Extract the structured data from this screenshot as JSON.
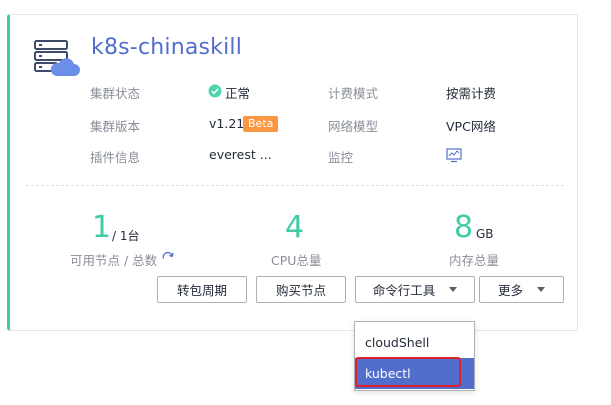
{
  "cluster": {
    "name": "k8s-chinaskill",
    "icon": "cluster-cloud-icon"
  },
  "info": {
    "status_label": "集群状态",
    "status_value": "正常",
    "status_icon": "check-circle-icon",
    "status_color": "#50d4ab",
    "version_label": "集群版本",
    "version_value": "v1.21",
    "version_badge": "Beta",
    "addons_label": "插件信息",
    "addons_value": "everest ...",
    "billing_label": "计费模式",
    "billing_value": "按需计费",
    "network_label": "网络模型",
    "network_value": "VPC网络",
    "monitor_label": "监控",
    "monitor_icon": "monitor-icon"
  },
  "stats": {
    "nodes_available": "1",
    "nodes_total": "/ 1台",
    "nodes_label": "可用节点 / 总数",
    "cpu_value": "4",
    "cpu_label": "CPU总量",
    "memory_value": "8",
    "memory_unit": "GB",
    "memory_label": "内存总量"
  },
  "actions": {
    "convert_period": "转包周期",
    "buy_node": "购买节点",
    "cli_tools": "命令行工具",
    "more": "更多"
  },
  "cli_menu": {
    "items": [
      "cloudShell",
      "kubectl"
    ],
    "hovered": "kubectl"
  },
  "colors": {
    "accent": "#3dcca6",
    "title_blue": "#526ecc",
    "badge_orange": "#fa9841",
    "highlight_red": "#e1202a"
  }
}
